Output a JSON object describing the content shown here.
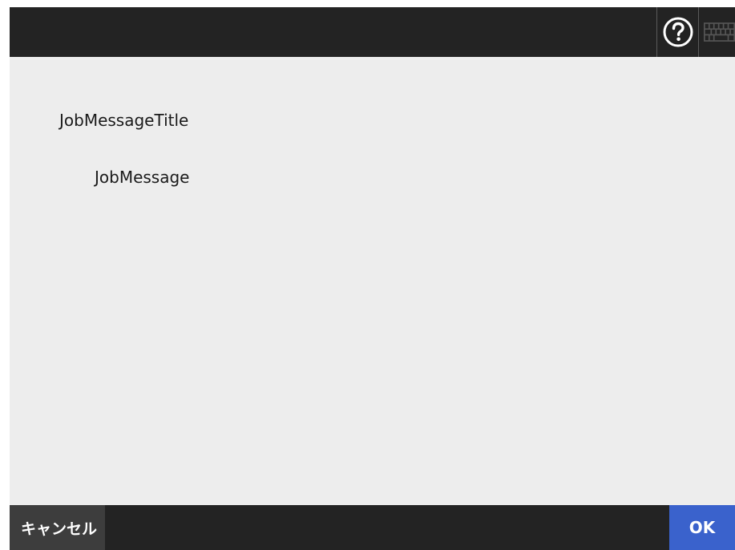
{
  "header": {
    "help_icon": "help-icon",
    "keyboard_icon": "keyboard-icon"
  },
  "message": {
    "title": "JobMessageTitle",
    "body": "JobMessage"
  },
  "footer": {
    "cancel_label": "キャンセル",
    "ok_label": "OK"
  },
  "colors": {
    "bar": "#232323",
    "background": "#ededed",
    "cancel_button": "#3d3d3d",
    "ok_button": "#3a62cc"
  }
}
